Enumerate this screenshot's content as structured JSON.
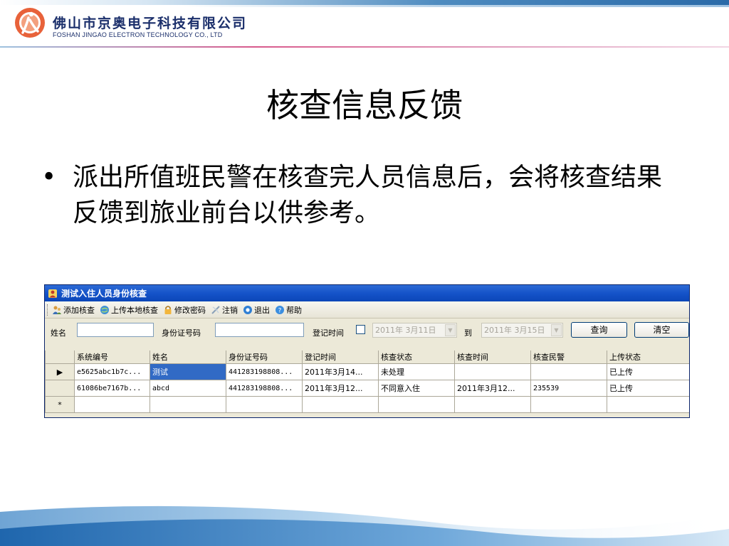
{
  "header": {
    "company_cn": "佛山市京奥电子科技有限公司",
    "company_en": "FOSHAN JINGAO ELECTRON TECHNOLOGY CO., LTD"
  },
  "slide": {
    "title": "核查信息反馈",
    "bullet_char": "•",
    "bullet_text": "派出所值班民警在核查完人员信息后，会将核查结果反馈到旅业前台以供参考。"
  },
  "window": {
    "title": "测试入住人员身份核查",
    "toolbar": [
      {
        "label": "添加核查",
        "icon": "users-icon"
      },
      {
        "label": "上传本地核查",
        "icon": "upload-globe-icon"
      },
      {
        "label": "修改密码",
        "icon": "lock-icon"
      },
      {
        "label": "注销",
        "icon": "logout-icon"
      },
      {
        "label": "退出",
        "icon": "exit-icon"
      },
      {
        "label": "帮助",
        "icon": "help-icon"
      }
    ],
    "filter": {
      "name_label": "姓名",
      "name_value": "",
      "id_label": "身份证号码",
      "id_value": "",
      "date_label": "登记时间",
      "date_from": "2011年 3月11日",
      "to_label": "到",
      "date_to": "2011年 3月15日",
      "query_button": "查询",
      "clear_button": "清空"
    },
    "grid": {
      "columns": [
        "系统编号",
        "姓名",
        "身份证号码",
        "登记时间",
        "核查状态",
        "核查时间",
        "核查民警",
        "上传状态"
      ],
      "rows": [
        {
          "indicator": "▶",
          "cells": [
            "e5625abc1b7c...",
            "测试",
            "441283198808...",
            "2011年3月14...",
            "未处理",
            "",
            "",
            "已上传"
          ]
        },
        {
          "indicator": "",
          "cells": [
            "61086be7167b...",
            "abcd",
            "441283198808...",
            "2011年3月12...",
            "不同意入住",
            "2011年3月12...",
            "235539",
            "已上传"
          ]
        }
      ],
      "new_row_indicator": "*"
    }
  }
}
